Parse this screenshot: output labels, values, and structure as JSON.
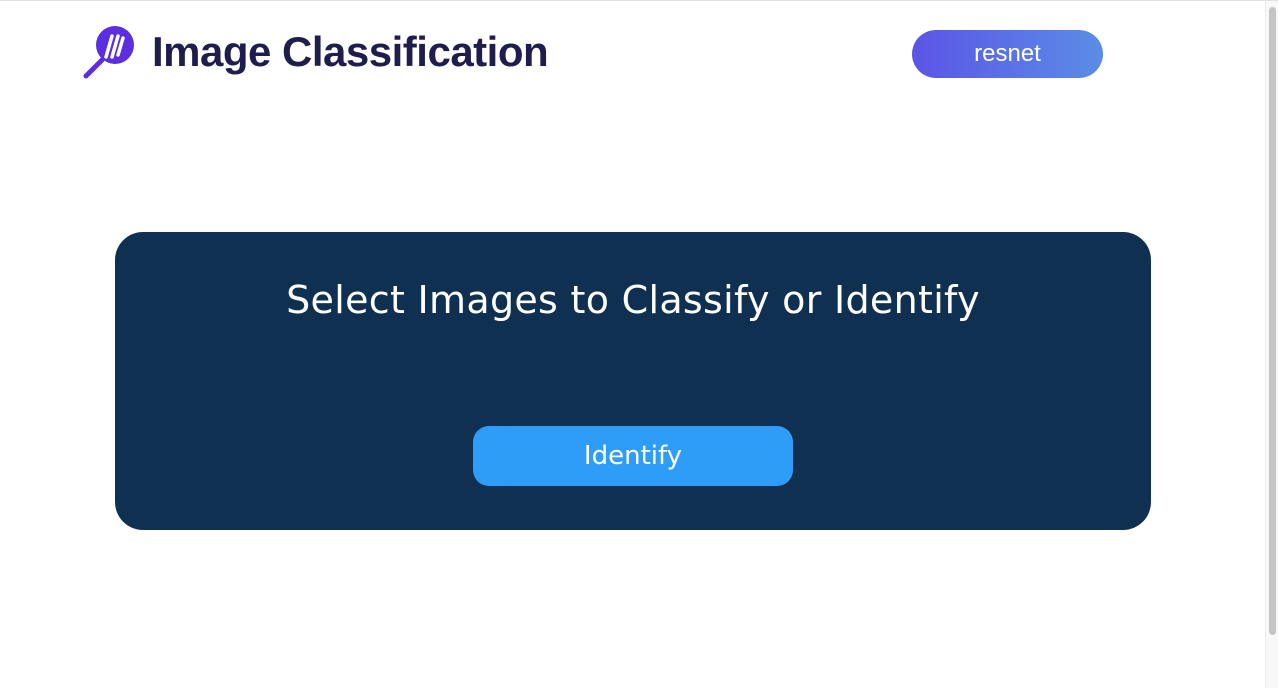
{
  "header": {
    "logo_icon": "magnifier-logo-icon",
    "title": "Image Classification",
    "model_label": "resnet"
  },
  "main": {
    "panel_title": "Select Images to Classify or Identify",
    "identify_label": "Identify"
  },
  "colors": {
    "title": "#1f1d4d",
    "accent_purple": "#5b2ee0",
    "pill_gradient_start": "#5b55e6",
    "pill_gradient_end": "#5b8de6",
    "panel_background": "#0f3050",
    "identify_button": "#2e9df8"
  }
}
